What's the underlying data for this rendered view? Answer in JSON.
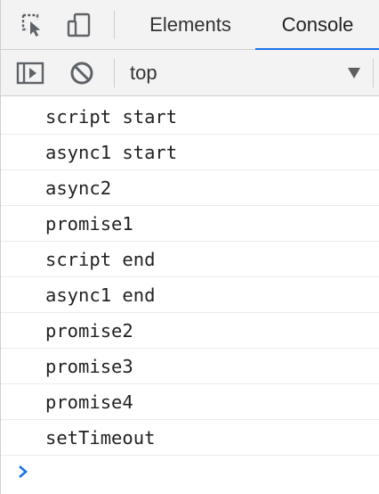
{
  "tabs": {
    "elements_label": "Elements",
    "console_label": "Console",
    "active": "Console"
  },
  "icons": {
    "inspect": "inspect-element-icon",
    "device": "device-toolbar-icon",
    "sidebar": "console-sidebar-icon",
    "clear": "clear-console-icon",
    "dropdown": "chevron-down-icon",
    "prompt": "console-prompt-icon"
  },
  "toolbar": {
    "context_label": "top"
  },
  "console": {
    "messages": [
      "script start",
      "async1 start",
      "async2",
      "promise1",
      "script end",
      "async1 end",
      "promise2",
      "promise3",
      "promise4",
      "setTimeout"
    ]
  },
  "colors": {
    "accent": "#1a73e8",
    "icon": "#5f6368",
    "toolbar_bg": "#f3f3f3"
  }
}
